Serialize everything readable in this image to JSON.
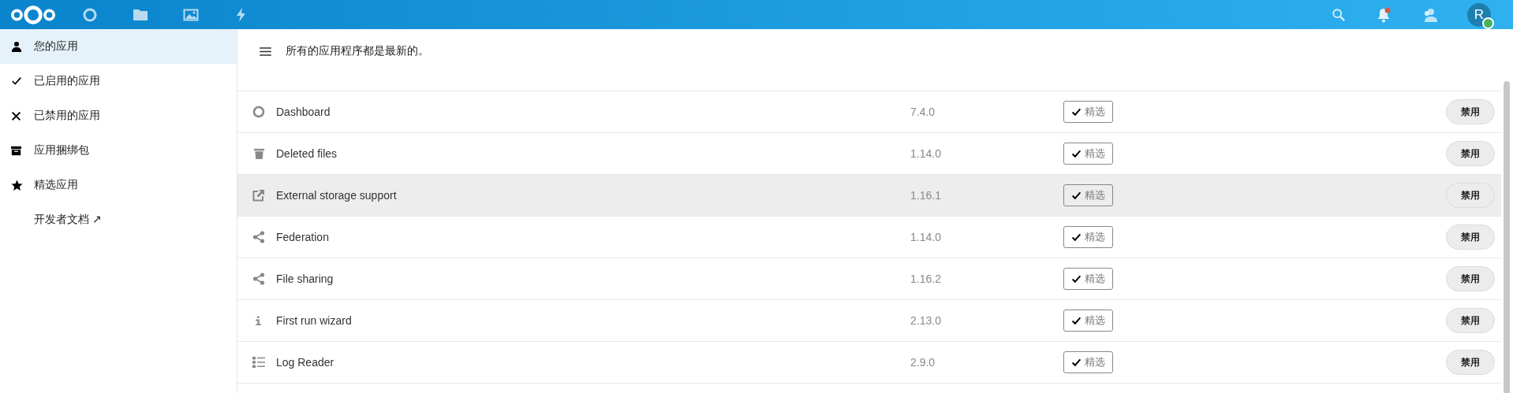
{
  "header": {
    "nav": [
      {
        "kind": "dashboard"
      },
      {
        "kind": "files"
      },
      {
        "kind": "photos"
      },
      {
        "kind": "activity"
      }
    ],
    "notifications": {
      "unread": true
    },
    "avatar": {
      "letter": "R"
    }
  },
  "sidebar": {
    "items": [
      {
        "kind": "person",
        "label": "您的应用",
        "selected": true
      },
      {
        "kind": "check",
        "label": "已启用的应用",
        "selected": false
      },
      {
        "kind": "cross",
        "label": "已禁用的应用",
        "selected": false
      },
      {
        "kind": "archive",
        "label": "应用捆绑包",
        "selected": false
      },
      {
        "kind": "star",
        "label": "精选应用",
        "selected": false
      },
      {
        "kind": "link",
        "label": "开发者文档 ↗",
        "selected": false
      }
    ]
  },
  "main": {
    "status": "所有的应用程序都是最新的。",
    "apps": [
      {
        "kind": "circle",
        "name": "Dashboard",
        "version": "7.4.0",
        "tag": "精选",
        "action": "禁用",
        "selected": false
      },
      {
        "kind": "trash",
        "name": "Deleted files",
        "version": "1.14.0",
        "tag": "精选",
        "action": "禁用",
        "selected": false
      },
      {
        "kind": "external",
        "name": "External storage support",
        "version": "1.16.1",
        "tag": "精选",
        "action": "禁用",
        "selected": true
      },
      {
        "kind": "share",
        "name": "Federation",
        "version": "1.14.0",
        "tag": "精选",
        "action": "禁用",
        "selected": false
      },
      {
        "kind": "share",
        "name": "File sharing",
        "version": "1.16.2",
        "tag": "精选",
        "action": "禁用",
        "selected": false
      },
      {
        "kind": "info",
        "name": "First run wizard",
        "version": "2.13.0",
        "tag": "精选",
        "action": "禁用",
        "selected": false
      },
      {
        "kind": "list",
        "name": "Log Reader",
        "version": "2.9.0",
        "tag": "精选",
        "action": "禁用",
        "selected": false
      }
    ]
  }
}
